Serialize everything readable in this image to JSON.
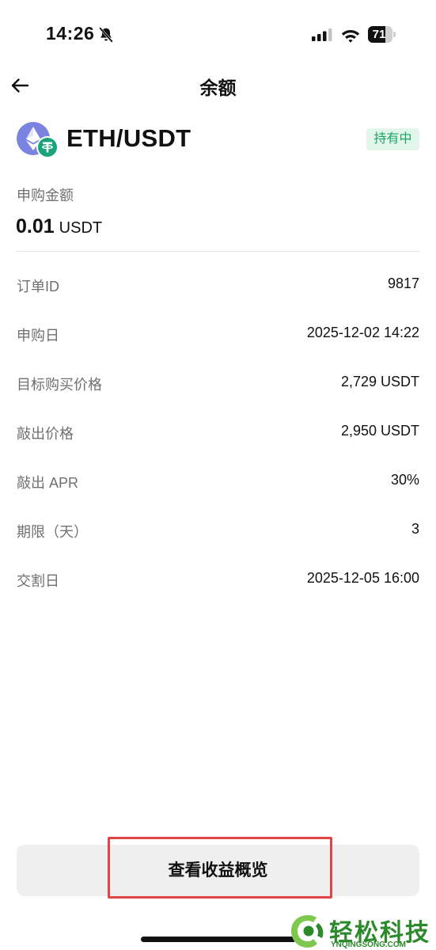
{
  "status_bar": {
    "time": "14:26",
    "battery_text": "71",
    "battery_level": 0.71
  },
  "nav": {
    "title": "余额"
  },
  "asset": {
    "pair": "ETH/USDT",
    "base_icon": "ethereum-icon",
    "quote_icon": "tether-icon",
    "status": "持有中",
    "status_color": "#1aa564"
  },
  "amount": {
    "label": "申购金额",
    "value": "0.01",
    "unit": "USDT"
  },
  "details": [
    {
      "label": "订单ID",
      "value": "9817"
    },
    {
      "label": "申购日",
      "value": "2025-12-02 14:22"
    },
    {
      "label": "目标购买价格",
      "value": "2,729 USDT"
    },
    {
      "label": "敲出价格",
      "value": "2,950 USDT"
    },
    {
      "label": "敲出 APR",
      "value": "30%"
    },
    {
      "label": "期限（天）",
      "value": "3"
    },
    {
      "label": "交割日",
      "value": "2025-12-05 16:00"
    }
  ],
  "actions": {
    "overview_button": "查看收益概览"
  },
  "watermark": {
    "title": "轻松科技",
    "subtitle": "YNQINGSONG.COM"
  },
  "colors": {
    "highlight": "#e04545",
    "badge_bg": "#e3f6ec",
    "eth": "#7b83e0",
    "usdt": "#1aa37a"
  }
}
